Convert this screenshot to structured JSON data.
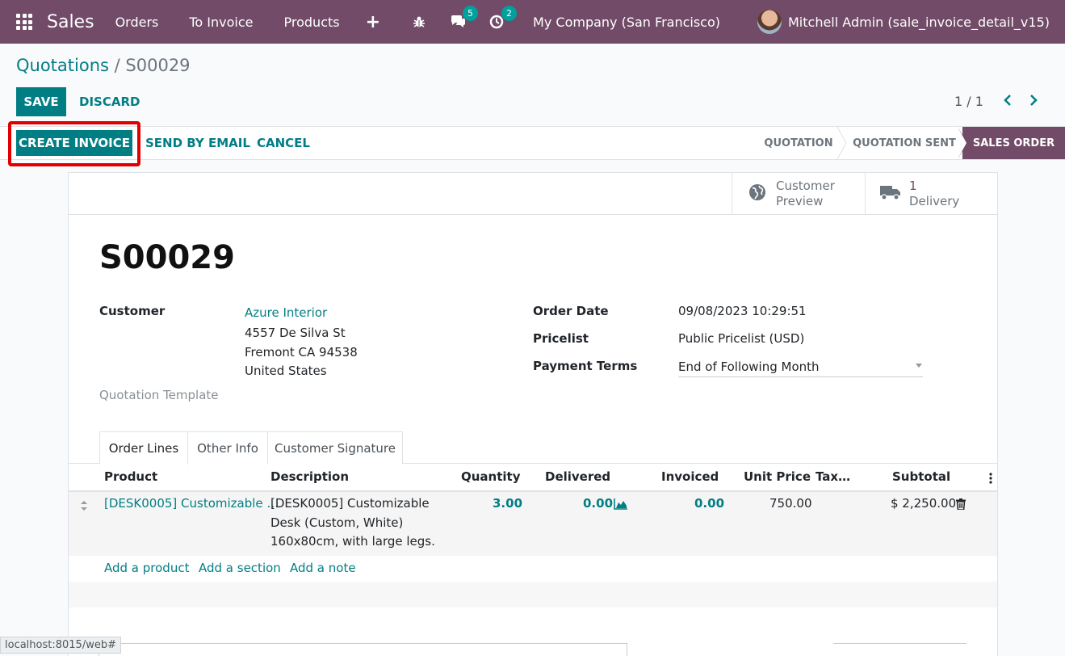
{
  "nav": {
    "app_name": "Sales",
    "menu": [
      "Orders",
      "To Invoice",
      "Products"
    ],
    "messages_count": "5",
    "activities_count": "2",
    "company": "My Company (San Francisco)",
    "user": "Mitchell Admin (sale_invoice_detail_v15)"
  },
  "breadcrumb": {
    "parent": "Quotations",
    "separator": " / ",
    "current": "S00029"
  },
  "controls": {
    "save": "SAVE",
    "discard": "DISCARD",
    "pager": "1 / 1"
  },
  "statusbar": {
    "create_invoice": "CREATE INVOICE",
    "send_email": "SEND BY EMAIL",
    "cancel": "CANCEL",
    "stages": [
      "QUOTATION",
      "QUOTATION SENT",
      "SALES ORDER"
    ],
    "active_stage": "SALES ORDER"
  },
  "smart_buttons": {
    "preview_line1": "Customer",
    "preview_line2": "Preview",
    "delivery_count": "1",
    "delivery_label": "Delivery"
  },
  "record": {
    "name": "S00029",
    "customer_label": "Customer",
    "customer_name": "Azure Interior",
    "address1": "4557 De Silva St",
    "address2": "Fremont CA 94538",
    "address3": "United States",
    "template_label": "Quotation Template",
    "order_date_label": "Order Date",
    "order_date": "09/08/2023 10:29:51",
    "pricelist_label": "Pricelist",
    "pricelist": "Public Pricelist (USD)",
    "payment_terms_label": "Payment Terms",
    "payment_terms": "End of Following Month"
  },
  "tabs": [
    "Order Lines",
    "Other Info",
    "Customer Signature"
  ],
  "table": {
    "headers": [
      "Product",
      "Description",
      "Quantity",
      "Delivered",
      "Invoiced",
      "Unit Price",
      "Tax…",
      "Subtotal"
    ],
    "row": {
      "product": "[DESK0005] Customizable …",
      "desc1": "[DESK0005] Customizable",
      "desc2": "Desk (Custom, White)",
      "desc3": "160x80cm, with large legs.",
      "quantity": "3.00",
      "delivered": "0.00",
      "invoiced": "0.00",
      "unit_price": "750.00",
      "subtotal": "$ 2,250.00"
    },
    "add_product": "Add a product",
    "add_section": "Add a section",
    "add_note": "Add a note"
  },
  "status_url": "localhost:8015/web#"
}
